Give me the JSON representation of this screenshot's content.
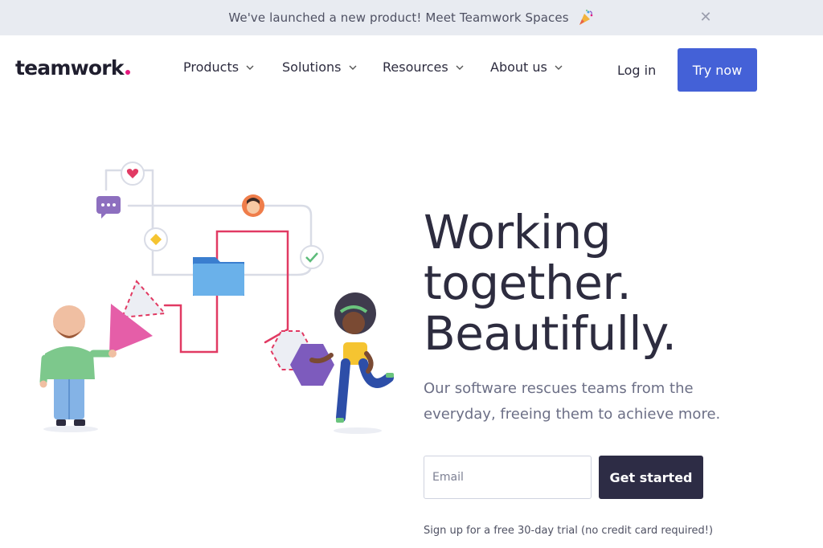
{
  "announcement": {
    "text": "We've launched a new product! Meet Teamwork Spaces",
    "emoji_icon": "party-popper-icon",
    "close_icon": "close-icon"
  },
  "nav": {
    "logo": "teamwork",
    "logo_dot_color": "#e6187d",
    "items": [
      {
        "label": "Products"
      },
      {
        "label": "Solutions"
      },
      {
        "label": "Resources"
      },
      {
        "label": "About us"
      }
    ],
    "login": "Log in",
    "cta": "Try now"
  },
  "hero": {
    "title_lines": [
      "Working",
      "together.",
      "Beautifully."
    ],
    "subtitle": "Our software rescues teams from the everyday, freeing them to achieve more.",
    "email_placeholder": "Email",
    "cta": "Get started",
    "fine_print": "Sign up for a free 30-day trial (no credit card required!)"
  },
  "colors": {
    "accent_blue": "#4461d7",
    "dark_button": "#2d2c45",
    "brand_pink": "#e6187d",
    "banner_bg": "#e8ebf1"
  }
}
